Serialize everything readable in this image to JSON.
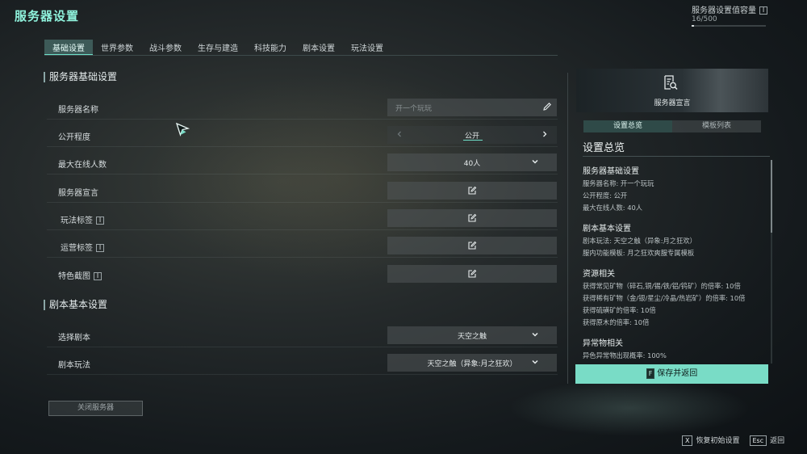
{
  "header": {
    "title": "服务器设置",
    "capacity_label": "服务器设置值容量",
    "capacity_info": "I",
    "capacity_value": "16/500",
    "capacity_fraction": 0.032
  },
  "tabs": [
    {
      "label": "基础设置",
      "active": true
    },
    {
      "label": "世界参数",
      "active": false
    },
    {
      "label": "战斗参数",
      "active": false
    },
    {
      "label": "生存与建造",
      "active": false
    },
    {
      "label": "科技能力",
      "active": false
    },
    {
      "label": "剧本设置",
      "active": false
    },
    {
      "label": "玩法设置",
      "active": false
    }
  ],
  "sections": {
    "basic": "服务器基础设置",
    "script": "剧本基本设置"
  },
  "rows": {
    "server_name": {
      "label": "服务器名称",
      "placeholder": "开一个玩玩"
    },
    "visibility": {
      "label": "公开程度",
      "value": "公开"
    },
    "max_players": {
      "label": "最大在线人数",
      "value": "40人"
    },
    "declaration": {
      "label": "服务器宣言"
    },
    "gameplay_tags": {
      "label": "玩法标签",
      "info": "I"
    },
    "ops_tags": {
      "label": "运营标签",
      "info": "I"
    },
    "screenshot": {
      "label": "特色截图",
      "info": "I"
    },
    "select_script": {
      "label": "选择剧本",
      "value": "天空之触"
    },
    "script_mode": {
      "label": "剧本玩法",
      "value": "天空之触（异象:月之狂欢）"
    }
  },
  "close_button": "关闭服务器",
  "right_panel": {
    "banner_label": "服务器宣言",
    "tabs": [
      {
        "label": "设置总览",
        "active": true
      },
      {
        "label": "模板列表",
        "active": false
      }
    ],
    "title": "设置总览",
    "groups": [
      {
        "heading": "服务器基础设置",
        "lines": [
          "服务器名称: 开一个玩玩",
          "公开程度: 公开",
          "最大在线人数: 40人"
        ]
      },
      {
        "heading": "剧本基本设置",
        "lines": [
          "剧本玩法: 天空之触（异象:月之狂欢）",
          "服内功能模板: 月之狂欢爽服专属模板"
        ]
      },
      {
        "heading": "资源相关",
        "lines": [
          "获得常见矿物（碎石,铜/锡/铁/铝/钨矿）的倍率: 10倍",
          "获得稀有矿物（金/银/星尘/冷晶/热岩矿）的倍率: 10倍",
          "获得硫磺矿的倍率: 10倍",
          "获得原木的倍率: 10倍"
        ]
      },
      {
        "heading": "异常物相关",
        "lines": [
          "异色异常物出现概率: 100%"
        ]
      }
    ],
    "save_key": "F",
    "save_label": "保存并返回"
  },
  "hints": [
    {
      "key": "X",
      "label": "恢复初始设置"
    },
    {
      "key": "Esc",
      "label": "返回"
    }
  ],
  "colors": {
    "accent": "#79dcc6",
    "title": "#8ff2dc",
    "tab_active_bg": "#3d5a58"
  }
}
